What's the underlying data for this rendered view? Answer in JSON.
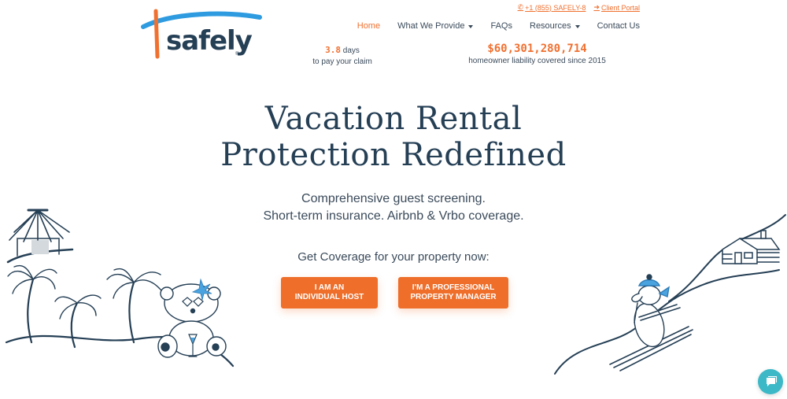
{
  "brand": {
    "name": "safely",
    "registered": "®",
    "accent": "#f07030",
    "navy": "#253f55",
    "sky": "#2e9be0"
  },
  "topbar": {
    "phone": {
      "icon": "phone-icon",
      "label": "+1 (855) SAFELY-8"
    },
    "portal": {
      "icon": "sign-in-icon",
      "label": "Client Portal"
    }
  },
  "nav": {
    "items": [
      {
        "label": "Home",
        "active": true,
        "dropdown": false
      },
      {
        "label": "What We Provide",
        "active": false,
        "dropdown": true
      },
      {
        "label": "FAQs",
        "active": false,
        "dropdown": false
      },
      {
        "label": "Resources",
        "active": false,
        "dropdown": true
      },
      {
        "label": "Contact Us",
        "active": false,
        "dropdown": false
      }
    ]
  },
  "stats": {
    "claim": {
      "value": "3.8",
      "unit": "days",
      "caption": "to pay your claim"
    },
    "liability": {
      "value": "$60,301,280,714",
      "caption": "homeowner liability covered since 2015"
    }
  },
  "hero": {
    "title_line1": "Vacation Rental",
    "title_line2": "Protection Redefined",
    "sub_line1": "Comprehensive guest screening.",
    "sub_line2": "Short-term insurance. Airbnb & Vrbo coverage.",
    "cta_text": "Get Coverage for your property now:",
    "buttons": [
      {
        "line1": "I AM AN",
        "line2": "INDIVIDUAL HOST"
      },
      {
        "line1": "I'M A PROFESSIONAL",
        "line2": "PROPERTY MANAGER"
      }
    ]
  },
  "chat": {
    "icon": "chat-bubble-icon",
    "color": "#3cb8c6"
  }
}
